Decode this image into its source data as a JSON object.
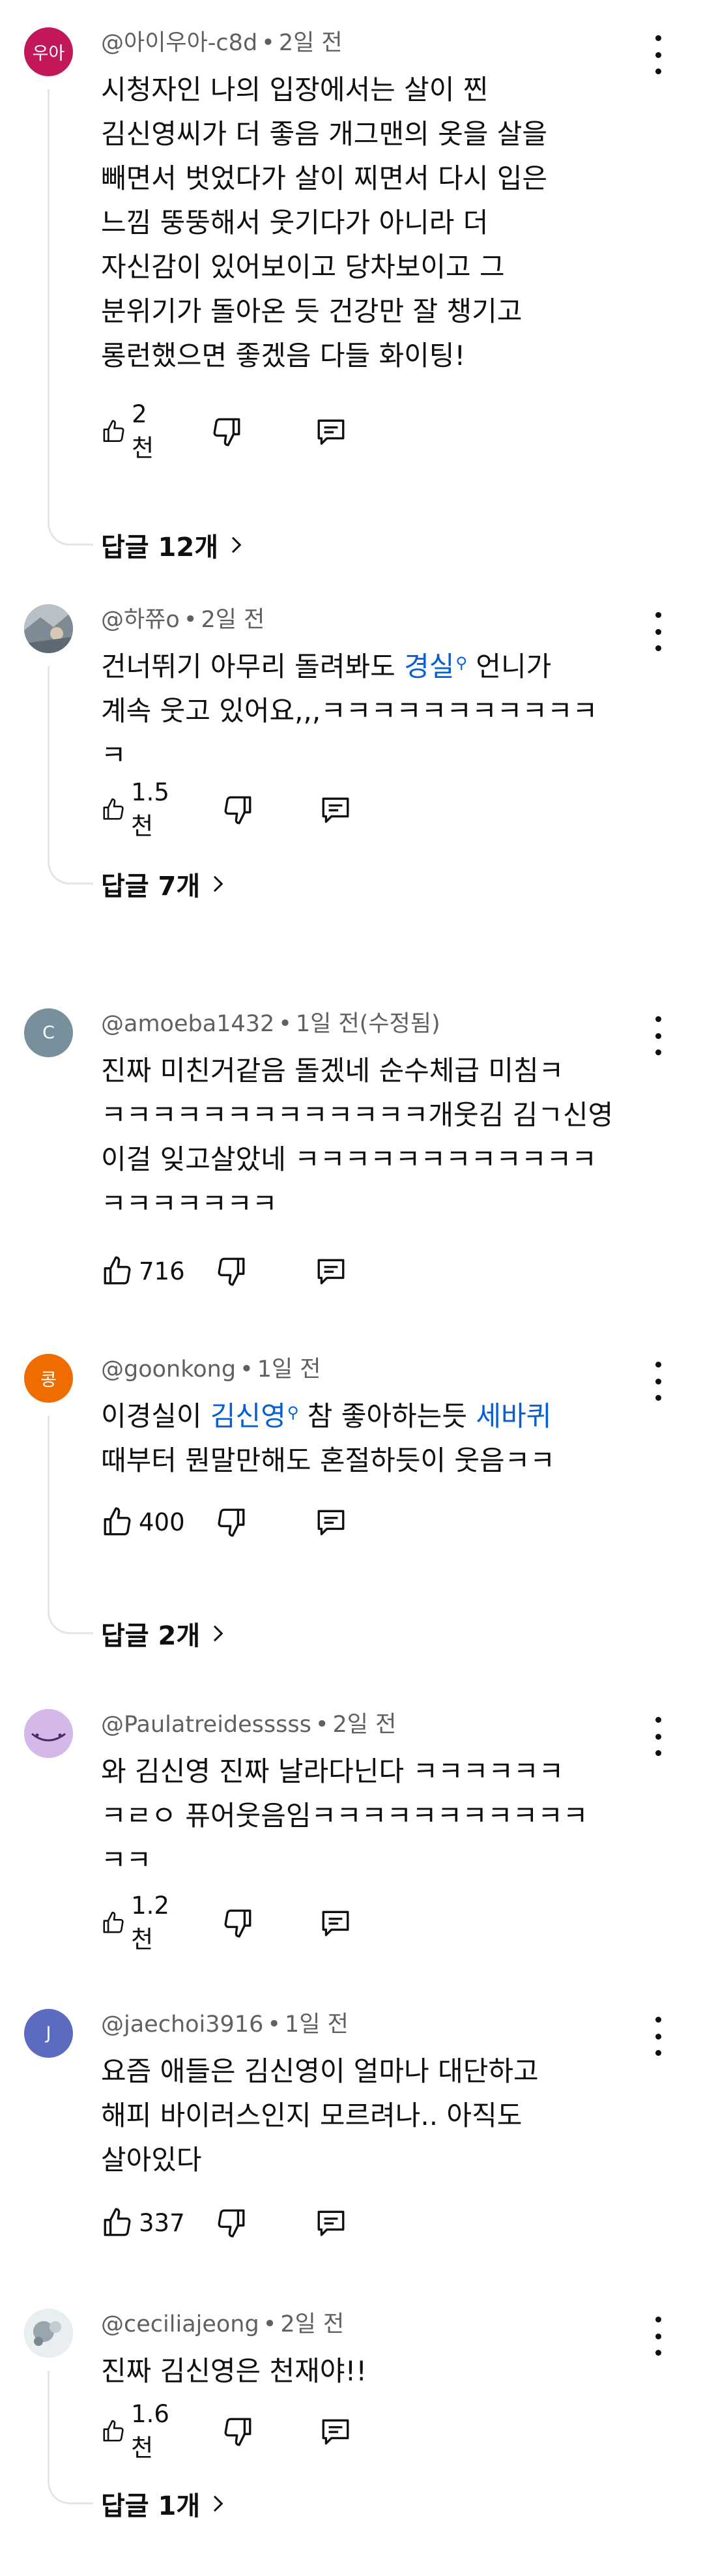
{
  "comments": [
    {
      "avatar_text": "우아",
      "avatar_color": "#c2185b",
      "author": "@아이우아-c8d",
      "time": "2일 전",
      "text": "시청자인 나의 입장에서는 살이 찐\n김신영씨가 더 좋음 개그맨의 옷을 살을\n빼면서 벗었다가 살이 찌면서 다시 입은\n느낌 뚱뚱해서 웃기다가 아니라 더\n자신감이 있어보이고 당차보이고 그\n분위기가 돌아온 듯 건강만 잘 챙기고\n롱런했으면 좋겠음 다들 화이팅!",
      "likes": "2천",
      "replies": "답글 12개"
    },
    {
      "avatar_text": "",
      "avatar_color": "#9aa5ad",
      "author": "@하쮸o",
      "time": "2일 전",
      "text_before": "건너뛰기 아무리 돌려봐도 ",
      "link": "경실",
      "text_after": " 언니가\n계속 웃고 있어요,,,ㅋㅋㅋㅋㅋㅋㅋㅋㅋㅋㅋ\nㅋ",
      "likes": "1.5천",
      "replies": "답글 7개"
    },
    {
      "avatar_text": "C",
      "avatar_color": "#78909c",
      "author": "@amoeba1432",
      "time": "1일 전(수정됨)",
      "text": "진짜 미친거같음 돌겠네 순수체급 미침ㅋ\nㅋㅋㅋㅋㅋㅋㅋㅋㅋㅋㅋㅋㅋ개웃김 김ㄱ신영\n이걸 잊고살았네 ㅋㅋㅋㅋㅋㅋㅋㅋㅋㅋㅋㅋ\nㅋㅋㅋㅋㅋㅋㅋ",
      "likes": "716"
    },
    {
      "avatar_text": "콩",
      "avatar_color": "#ef6c00",
      "author": "@goonkong",
      "time": "1일 전",
      "text_before": "이경실이 ",
      "link": "김신영",
      "text_middle": " 참 좋아하는듯 ",
      "link2": "세바퀴",
      "text_after": "\n때부터 뭔말만해도 혼절하듯이 웃음ㅋㅋ",
      "likes": "400",
      "replies": "답글 2개"
    },
    {
      "avatar_text": "",
      "avatar_color": "#c9a9e0",
      "author": "@Paulatreidesssss",
      "time": "2일 전",
      "text": "와 김신영 진짜 날라다닌다 ㅋㅋㅋㅋㅋㅋ\nㅋㄹㅇ 퓨어웃음임ㅋㅋㅋㅋㅋㅋㅋㅋㅋㅋㅋ\nㅋㅋ",
      "likes": "1.2천"
    },
    {
      "avatar_text": "J",
      "avatar_color": "#5c6bc0",
      "author": "@jaechoi3916",
      "time": "1일 전",
      "text": "요즘 애들은 김신영이 얼마나 대단하고\n해피 바이러스인지 모르려나.. 아직도\n살아있다",
      "likes": "337"
    },
    {
      "avatar_text": "",
      "avatar_color": "#b0b8bf",
      "author": "@ceciliajeong",
      "time": "2일 전",
      "text": "진짜 김신영은 천재야!!",
      "likes": "1.6천",
      "replies": "답글 1개"
    }
  ],
  "icons": {
    "like": "thumb-up-icon",
    "dislike": "thumb-down-icon",
    "reply": "reply-comment-icon",
    "more": "more-vertical-icon",
    "replies_arrow": "chevron-right-icon"
  }
}
